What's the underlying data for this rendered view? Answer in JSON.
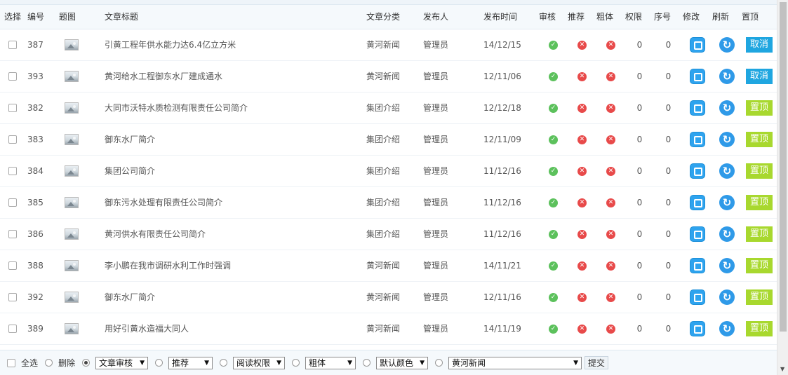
{
  "headers": {
    "select": "选择",
    "id": "编号",
    "image": "题图",
    "title": "文章标题",
    "category": "文章分类",
    "publisher": "发布人",
    "time": "发布时间",
    "review": "审核",
    "recommend": "推荐",
    "bold": "粗体",
    "permission": "权限",
    "order": "序号",
    "edit": "修改",
    "refresh": "刷新",
    "pin": "置顶"
  },
  "rows": [
    {
      "id": "387",
      "title": "引黄工程年供水能力达6.4亿立方米",
      "category": "黄河新闻",
      "publisher": "管理员",
      "time": "14/12/15",
      "permission": "0",
      "order": "0",
      "pin_label": "取消",
      "pinned": true
    },
    {
      "id": "393",
      "title": "黄河给水工程御东水厂建成通水",
      "category": "黄河新闻",
      "publisher": "管理员",
      "time": "12/11/06",
      "permission": "0",
      "order": "0",
      "pin_label": "取消",
      "pinned": true
    },
    {
      "id": "382",
      "title": "大同市沃特水质检测有限责任公司简介",
      "category": "集团介绍",
      "publisher": "管理员",
      "time": "12/12/18",
      "permission": "0",
      "order": "0",
      "pin_label": "置顶",
      "pinned": false
    },
    {
      "id": "383",
      "title": "御东水厂简介",
      "category": "集团介绍",
      "publisher": "管理员",
      "time": "12/11/09",
      "permission": "0",
      "order": "0",
      "pin_label": "置顶",
      "pinned": false
    },
    {
      "id": "384",
      "title": "集团公司简介",
      "category": "集团介绍",
      "publisher": "管理员",
      "time": "11/12/16",
      "permission": "0",
      "order": "0",
      "pin_label": "置顶",
      "pinned": false
    },
    {
      "id": "385",
      "title": "御东污水处理有限责任公司简介",
      "category": "集团介绍",
      "publisher": "管理员",
      "time": "11/12/16",
      "permission": "0",
      "order": "0",
      "pin_label": "置顶",
      "pinned": false
    },
    {
      "id": "386",
      "title": "黄河供水有限责任公司简介",
      "category": "集团介绍",
      "publisher": "管理员",
      "time": "11/12/16",
      "permission": "0",
      "order": "0",
      "pin_label": "置顶",
      "pinned": false
    },
    {
      "id": "388",
      "title": "李小鹏在我市调研水利工作时强调",
      "category": "黄河新闻",
      "publisher": "管理员",
      "time": "14/11/21",
      "permission": "0",
      "order": "0",
      "pin_label": "置顶",
      "pinned": false
    },
    {
      "id": "392",
      "title": "御东水厂简介",
      "category": "黄河新闻",
      "publisher": "管理员",
      "time": "12/11/16",
      "permission": "0",
      "order": "0",
      "pin_label": "置顶",
      "pinned": false
    },
    {
      "id": "389",
      "title": "用好引黄水造福大同人",
      "category": "黄河新闻",
      "publisher": "管理员",
      "time": "14/11/19",
      "permission": "0",
      "order": "0",
      "pin_label": "置顶",
      "pinned": false
    }
  ],
  "icons": {
    "image": "image-thumbnail-icon",
    "review": "check-circle-icon",
    "recommend": "x-circle-icon",
    "bold": "x-circle-icon",
    "edit": "edit-icon",
    "refresh": "refresh-icon"
  },
  "colors": {
    "cancel": "#1fa6e0",
    "pin": "#a8d82e",
    "ok": "#5cc15c",
    "no": "#e84a4a",
    "edit": "#2ea3ee"
  },
  "bottom": {
    "select_all": "全选",
    "delete": "删除",
    "review_select": "文章审核",
    "recommend_select": "推荐",
    "permission_select": "阅读权限",
    "bold_select": "粗体",
    "color_select": "默认颜色",
    "category_select": "黄河新闻",
    "submit": "提交"
  }
}
